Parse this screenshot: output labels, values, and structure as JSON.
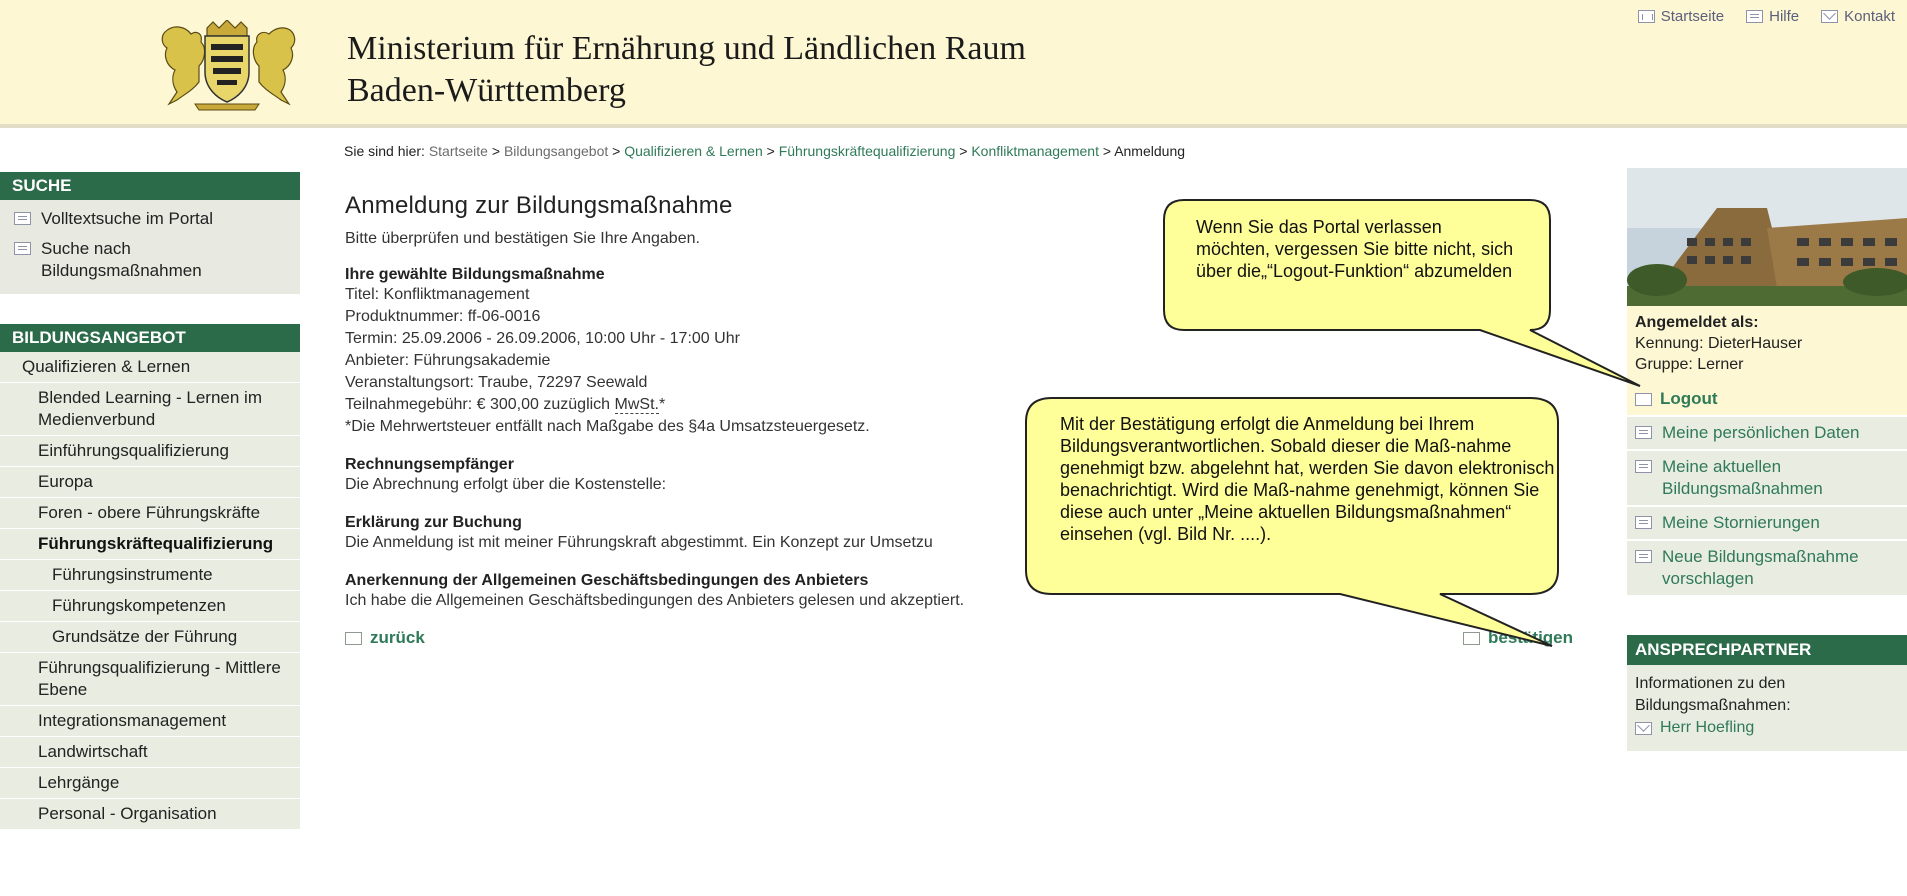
{
  "header": {
    "title_line1": "Ministerium für Ernährung und Ländlichen Raum",
    "title_line2": "Baden-Württemberg",
    "top_links": [
      {
        "icon": "home-icon",
        "label": "Startseite"
      },
      {
        "icon": "document-icon",
        "label": "Hilfe"
      },
      {
        "icon": "mail-icon",
        "label": "Kontakt"
      }
    ]
  },
  "breadcrumb": {
    "prefix": "Sie sind hier:",
    "items": [
      "Startseite",
      "Bildungsangebot",
      "Qualifizieren & Lernen",
      "Führungskräftequalifizierung",
      "Konfliktmanagement"
    ],
    "separator": ">",
    "current": "Anmeldung"
  },
  "sidebar": {
    "search_heading": "SUCHE",
    "search_items": [
      "Volltextsuche im Portal",
      "Suche nach Bildungsmaßnahmen"
    ],
    "offer_heading": "BILDUNGSANGEBOT",
    "offer_items": [
      "Qualifizieren & Lernen",
      "Blended Learning - Lernen im Medienverbund",
      "Einführungsqualifizierung",
      "Europa",
      "Foren - obere Führungskräfte",
      "Führungskräftequalifizierung",
      "Führungsinstrumente",
      "Führungskompetenzen",
      "Grundsätze der Führung",
      "Führungsqualifizierung - Mittlere Ebene",
      "Integrationsmanagement",
      "Landwirtschaft",
      "Lehrgänge",
      "Personal - Organisation"
    ]
  },
  "main": {
    "title": "Anmeldung zur Bildungsmaßnahme",
    "intro": "Bitte überprüfen und bestätigen Sie Ihre Angaben.",
    "measure": {
      "heading": "Ihre gewählte Bildungsmaßnahme",
      "titel": "Titel: Konfliktmanagement",
      "produktnummer": "Produktnummer: ff-06-0016",
      "termin": "Termin: 25.09.2006 - 26.09.2006, 10:00 Uhr - 17:00 Uhr",
      "anbieter": "Anbieter: Führungsakademie",
      "ort": "Veranstaltungsort: Traube, 72297 Seewald",
      "gebuehr_prefix": "Teilnahmegebühr: € 300,00 zuzüglich ",
      "gebuehr_mwst": "MwSt.",
      "gebuehr_suffix": "*",
      "footnote": "*Die Mehrwertsteuer entfällt nach Maßgabe des §4a Umsatzsteuergesetz."
    },
    "billing": {
      "heading": "Rechnungsempfänger",
      "text": "Die Abrechnung erfolgt über die Kostenstelle:"
    },
    "declaration": {
      "heading": "Erklärung zur Buchung",
      "text": "Die Anmeldung ist mit meiner Führungskraft abgestimmt. Ein Konzept zur Umsetzu"
    },
    "terms": {
      "heading": "Anerkennung der Allgemeinen Geschäftsbedingungen des Anbieters",
      "text": "Ich habe die Allgemeinen Geschäftsbedingungen des Anbieters gelesen und akzeptiert."
    },
    "back_label": "zurück",
    "confirm_label": "bestätigen"
  },
  "right": {
    "logged_in_heading": "Angemeldet als:",
    "kennung": "Kennung: DieterHauser",
    "gruppe": "Gruppe: Lerner",
    "logout_label": "Logout",
    "links": [
      "Meine persönlichen Daten",
      "Meine aktuellen Bildungsmaßnahmen",
      "Meine Stornierungen",
      "Neue Bildungsmaßnahme vorschlagen"
    ],
    "contact_heading": "ANSPRECHPARTNER",
    "contact_text": "Informationen zu den Bildungsmaßnahmen:",
    "contact_person": "Herr Hoefling"
  },
  "callouts": {
    "logout_hint": "Wenn Sie das Portal verlassen möchten, vergessen Sie bitte nicht, sich über die„“Logout-Funktion“ abzumelden",
    "confirm_hint": "Mit der Bestätigung erfolgt die Anmeldung bei Ihrem Bildungsverantwortlichen. Sobald dieser die Maß-nahme genehmigt bzw. abgelehnt hat, werden Sie davon elektronisch benachrichtigt. Wird die Maß-nahme genehmigt, können Sie diese auch unter „Meine aktuellen Bildungsmaßnahmen“ einsehen (vgl. Bild Nr. ....)."
  },
  "colors": {
    "header_bg": "#fdf7d4",
    "heading_green": "#2c6b4a",
    "link_green": "#2f7a58",
    "sidebar_bg": "#e9ece1",
    "callout_bg": "#ffff99"
  }
}
